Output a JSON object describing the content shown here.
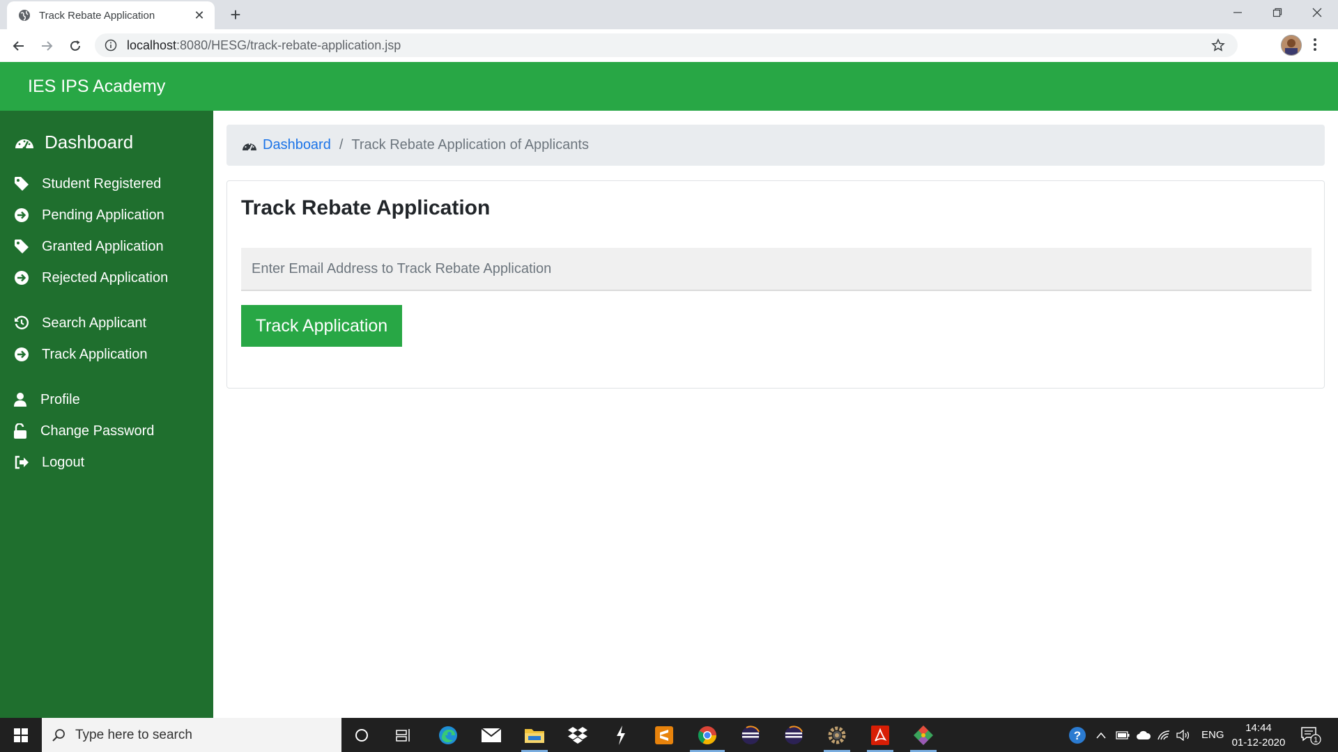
{
  "browser": {
    "tab_title": "Track Rebate Application",
    "url_host": "localhost",
    "url_rest": ":8080/HESG/track-rebate-application.jsp"
  },
  "app": {
    "brand": "IES IPS Academy",
    "accent_color": "#28a745",
    "sidebar_color": "#1f6f2e"
  },
  "sidebar": {
    "dashboard": "Dashboard",
    "items": [
      {
        "label": "Student Registered",
        "icon": "tag-icon"
      },
      {
        "label": "Pending Application",
        "icon": "arrow-circle-right-icon"
      },
      {
        "label": "Granted Application",
        "icon": "tag-icon"
      },
      {
        "label": "Rejected Application",
        "icon": "arrow-circle-right-icon"
      },
      {
        "label": "Search Applicant",
        "icon": "history-icon"
      },
      {
        "label": "Track Application",
        "icon": "arrow-circle-right-icon"
      },
      {
        "label": "Profile",
        "icon": "user-icon"
      },
      {
        "label": "Change Password",
        "icon": "unlock-icon"
      },
      {
        "label": "Logout",
        "icon": "sign-out-icon"
      }
    ]
  },
  "breadcrumb": {
    "link": "Dashboard",
    "separator": "/",
    "current": "Track Rebate Application of Applicants"
  },
  "card": {
    "title": "Track Rebate Application",
    "email_placeholder": "Enter Email Address to Track Rebate Application",
    "email_value": "",
    "button_label": "Track Application"
  },
  "taskbar": {
    "search_placeholder": "Type here to search",
    "language": "ENG",
    "time": "14:44",
    "date": "01-12-2020",
    "notification_count": "1"
  }
}
